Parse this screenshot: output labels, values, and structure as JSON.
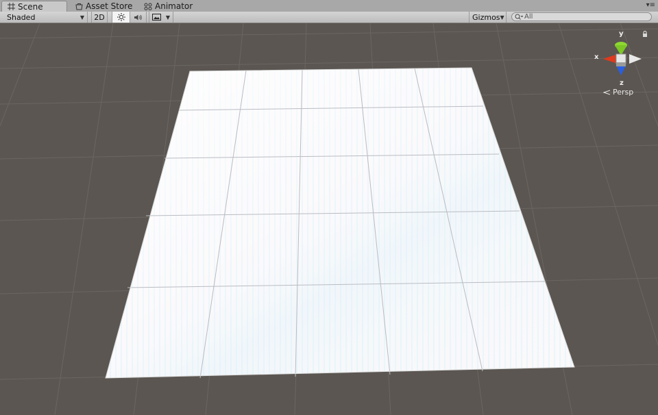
{
  "tabs": [
    {
      "label": "Scene",
      "icon": "grid-icon",
      "active": true
    },
    {
      "label": "Asset Store",
      "icon": "store-icon",
      "active": false
    },
    {
      "label": "Animator",
      "icon": "animator-icon",
      "active": false
    }
  ],
  "toolbar": {
    "shading_mode": "Shaded",
    "mode_2d_label": "2D",
    "lighting_icon": "sun-icon",
    "audio_icon": "speaker-icon",
    "effects_icon": "image-icon",
    "gizmos_label": "Gizmos",
    "search_placeholder": "All"
  },
  "scene_gizmo": {
    "x_label": "x",
    "y_label": "y",
    "z_label": "z",
    "projection_label": "Persp",
    "colors": {
      "x": "#e03a1e",
      "y": "#8fd832",
      "z": "#2a5fe0"
    }
  },
  "colors": {
    "viewport_bg": "#5b5651",
    "grid_line": "#6a6560",
    "plane": "#fbf8fa"
  }
}
